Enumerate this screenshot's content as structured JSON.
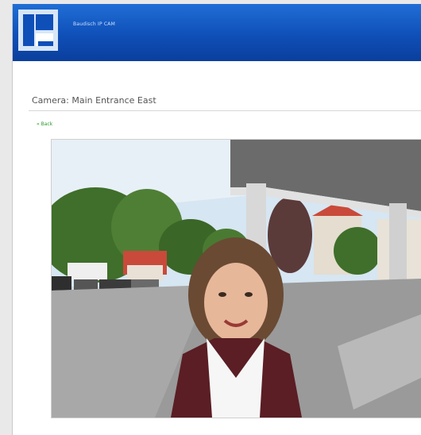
{
  "header": {
    "brand_text": "Baudisch IP CAM",
    "logo_icon": "company-logo-icon",
    "colors": {
      "header_top": "#1f6fd6",
      "header_bottom": "#0a3f9c"
    }
  },
  "page": {
    "title": "Camera: Main Entrance East",
    "back_label": "« Back"
  },
  "camera": {
    "feed_name": "camera-live-image",
    "accent_colors": {
      "sky": "#d6e6f2",
      "pavement": "#9a9a9a",
      "foliage": "#3f6f2a"
    }
  }
}
